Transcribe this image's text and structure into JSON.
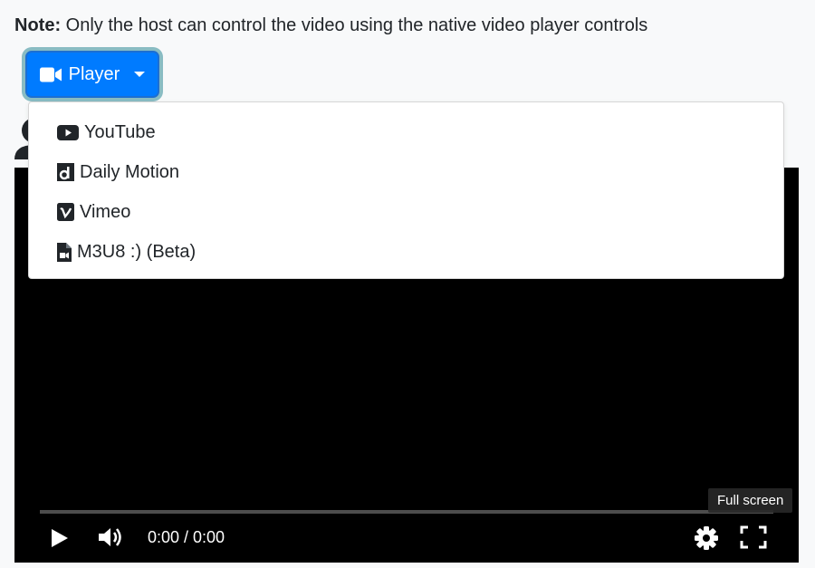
{
  "note": {
    "label": "Note:",
    "text": " Only the host can control the video using the native video player controls"
  },
  "player_button": {
    "label": "Player",
    "icon": "video-camera-icon",
    "color": "#007bff"
  },
  "dropdown": {
    "items": [
      {
        "label": "YouTube",
        "icon": "youtube-icon"
      },
      {
        "label": "Daily Motion",
        "icon": "dailymotion-icon"
      },
      {
        "label": "Vimeo",
        "icon": "vimeo-icon"
      },
      {
        "label": "M3U8 :) (Beta)",
        "icon": "file-video-icon"
      }
    ]
  },
  "video": {
    "time": "0:00 / 0:00",
    "progress": 0,
    "tooltip": "Full screen"
  }
}
